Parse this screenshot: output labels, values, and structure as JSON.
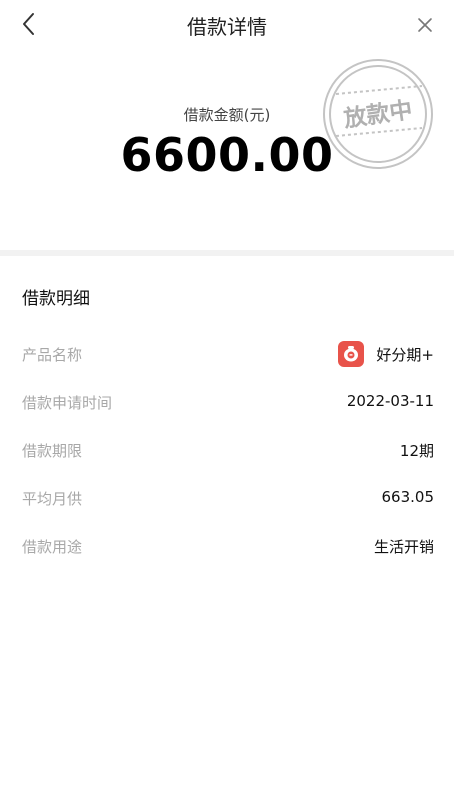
{
  "header": {
    "title": "借款详情"
  },
  "amount": {
    "label": "借款金额(元)",
    "value": "6600.00",
    "status_stamp": "放款中"
  },
  "details": {
    "section_title": "借款明细",
    "rows": [
      {
        "label": "产品名称",
        "value": "好分期+",
        "icon": "product-app-icon"
      },
      {
        "label": "借款申请时间",
        "value": "2022-03-11"
      },
      {
        "label": "借款期限",
        "value": "12期"
      },
      {
        "label": "平均月供",
        "value": "663.05"
      },
      {
        "label": "借款用途",
        "value": "生活开销"
      }
    ]
  },
  "colors": {
    "background": "#ffffff",
    "divider": "#f2f2f2",
    "label_gray": "#a8a8a8",
    "stamp_gray": "#b0b0b0",
    "brand_red": "#e8534a"
  }
}
